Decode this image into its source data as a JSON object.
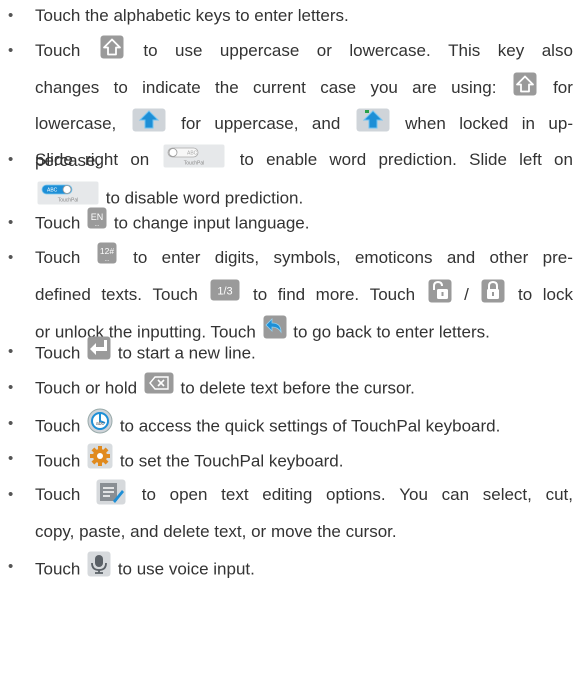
{
  "bullet": "•",
  "items": [
    {
      "lines": [
        [
          "Touch the alphabetic keys to enter letters."
        ]
      ]
    },
    {
      "lines": [
        [
          "Touch",
          {
            "icon": "shift-lowercase-icon"
          },
          "to use uppercase or lowercase. This key also"
        ],
        [
          "changes to indicate the current case you are using:",
          {
            "icon": "shift-lowercase-icon"
          },
          "for"
        ],
        [
          "lowercase,",
          {
            "icon": "shift-uppercase-icon"
          },
          "for uppercase, and",
          {
            "icon": "shift-locked-icon"
          },
          "when locked in up-"
        ],
        [
          "percase."
        ]
      ]
    },
    {
      "lines": [
        [
          "Slide right on",
          {
            "icon": "prediction-off-toggle-icon"
          },
          "to enable word prediction. Slide left on"
        ],
        [
          {
            "icon": "prediction-on-toggle-icon"
          },
          "to disable word prediction."
        ]
      ]
    },
    {
      "lines": [
        [
          "Touch",
          {
            "icon": "language-key-icon"
          },
          "to change input language."
        ]
      ]
    },
    {
      "lines": [
        [
          "Touch",
          {
            "icon": "symbol-key-icon"
          },
          "to enter digits, symbols, emoticons and other pre-"
        ],
        [
          "defined texts. Touch",
          {
            "icon": "page-key-icon"
          },
          "to find more. Touch",
          {
            "icon": "unlock-icon"
          },
          "/",
          {
            "icon": "lock-icon"
          },
          "to lock"
        ],
        [
          "or unlock the inputting. Touch",
          {
            "icon": "back-icon"
          },
          "to go back to enter letters."
        ]
      ]
    },
    {
      "lines": [
        [
          "Touch",
          {
            "icon": "enter-icon"
          },
          "to start a new line."
        ]
      ]
    },
    {
      "lines": [
        [
          "Touch or hold",
          {
            "icon": "backspace-icon"
          },
          "to delete text before the cursor."
        ]
      ]
    },
    {
      "lines": [
        [
          "Touch",
          {
            "icon": "quick-settings-icon"
          },
          "to access the quick settings of TouchPal keyboard."
        ]
      ]
    },
    {
      "lines": [
        [
          "Touch",
          {
            "icon": "settings-gear-icon"
          },
          "to set the TouchPal keyboard."
        ]
      ]
    },
    {
      "lines": [
        [
          "Touch",
          {
            "icon": "text-edit-icon"
          },
          "to open text editing options. You can select, cut,"
        ],
        [
          "copy, paste, and delete text, or move the cursor."
        ]
      ]
    },
    {
      "lines": [
        [
          "Touch",
          {
            "icon": "microphone-icon"
          },
          "to use voice input."
        ]
      ]
    }
  ],
  "icon_labels": {
    "prediction_toggle": "TouchPal",
    "toggle_badge": "ABC",
    "language_key": "EN",
    "symbol_key": "12#",
    "page_key": "1/3"
  },
  "colors": {
    "text": "#333333",
    "key_gray": "#9a9a9a",
    "key_blue": "#1e8fd6",
    "gear": "#e08a1e"
  }
}
